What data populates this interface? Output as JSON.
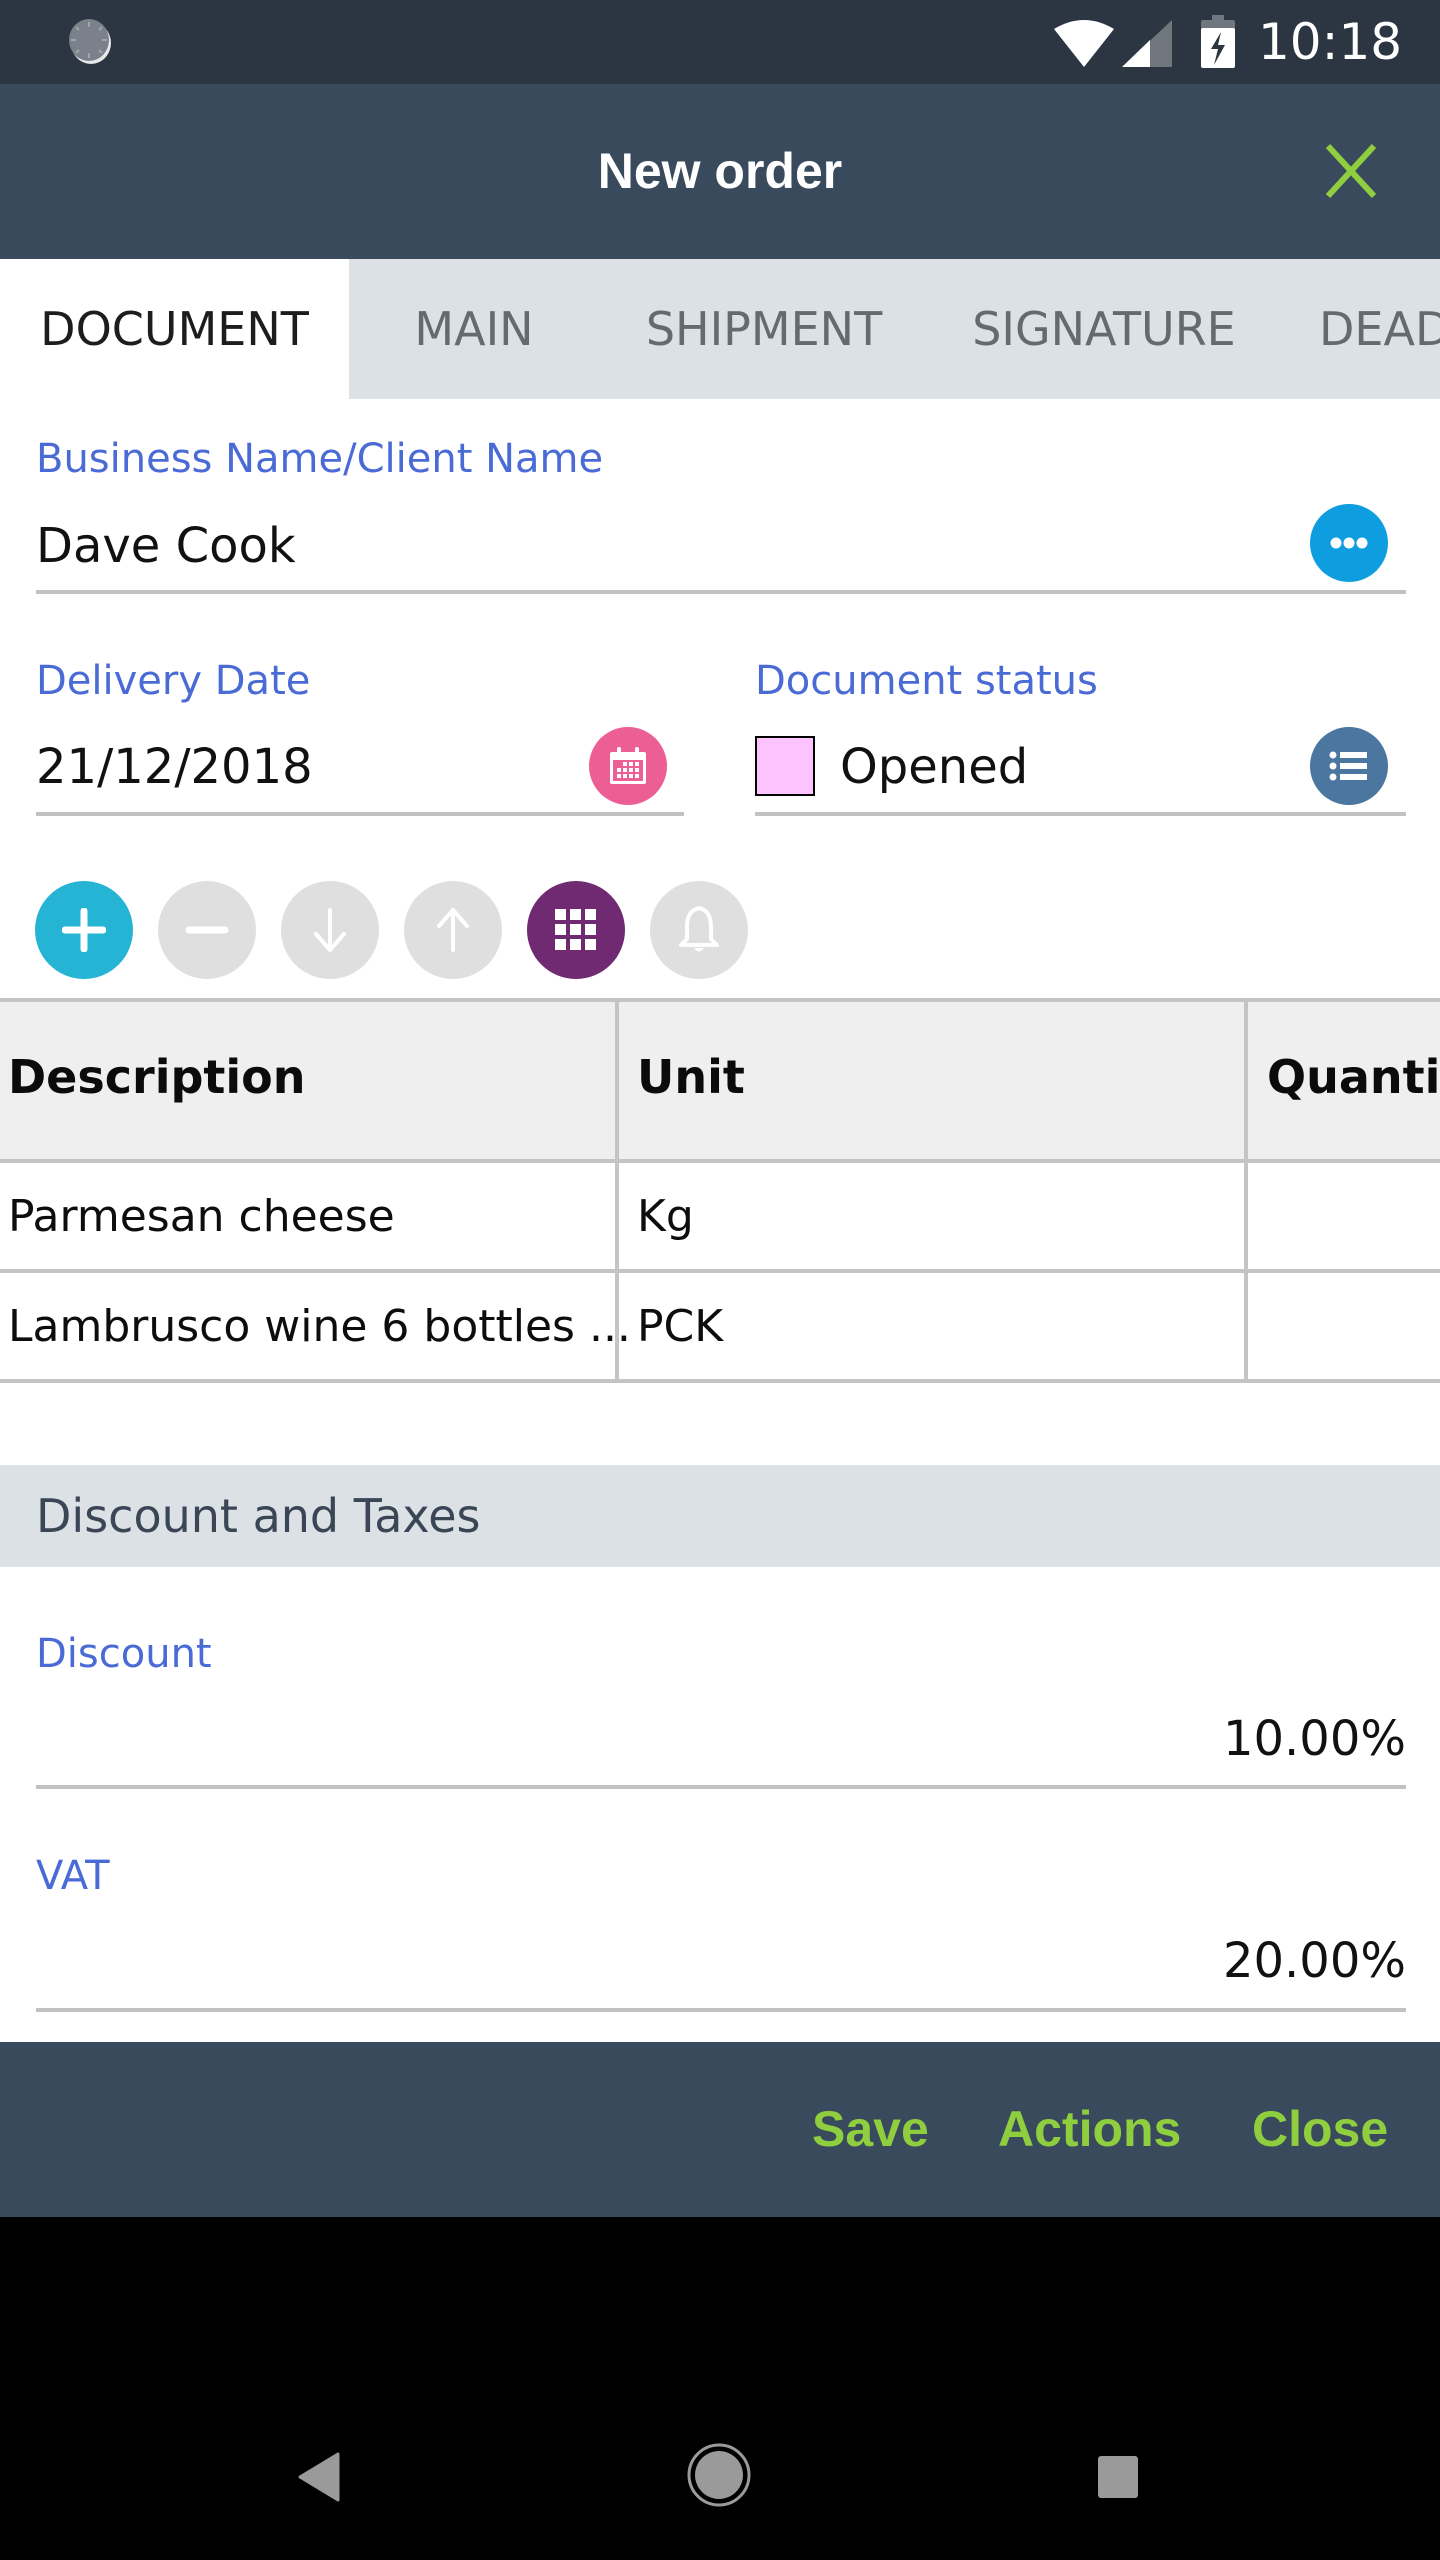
{
  "status_bar": {
    "time": "10:18",
    "icons": [
      "loading-indicator-icon",
      "wifi-icon",
      "cell-signal-icon",
      "battery-charging-icon"
    ]
  },
  "app_bar": {
    "title": "New order",
    "close_icon": "close-icon",
    "accent_color": "#8fce3f"
  },
  "tabs": [
    {
      "label": "DOCUMENT",
      "active": true
    },
    {
      "label": "MAIN",
      "active": false
    },
    {
      "label": "SHIPMENT",
      "active": false
    },
    {
      "label": "SIGNATURE",
      "active": false
    },
    {
      "label": "DEAD",
      "active": false
    }
  ],
  "form": {
    "client": {
      "label": "Business Name/Client Name",
      "value": "Dave Cook",
      "button_icon": "more-dots-icon",
      "button_color": "#0e9ee0"
    },
    "delivery_date": {
      "label": "Delivery Date",
      "value": "21/12/2018",
      "button_icon": "calendar-icon",
      "button_color": "#ec5f95"
    },
    "document_status": {
      "label": "Document status",
      "value": "Opened",
      "swatch_color": "#fdc3ff",
      "button_icon": "list-icon",
      "button_color": "#4a76a0"
    }
  },
  "row_actions": [
    {
      "name": "add",
      "icon": "plus-icon",
      "color": "#25b4d3",
      "enabled": true
    },
    {
      "name": "remove",
      "icon": "minus-icon",
      "color": "#dfdfdf",
      "enabled": false
    },
    {
      "name": "move-down",
      "icon": "arrow-down-icon",
      "color": "#dfdfdf",
      "enabled": false
    },
    {
      "name": "move-up",
      "icon": "arrow-up-icon",
      "color": "#dfdfdf",
      "enabled": false
    },
    {
      "name": "grid",
      "icon": "grid-icon",
      "color": "#702a72",
      "enabled": true
    },
    {
      "name": "notify",
      "icon": "bell-icon",
      "color": "#dfdfdf",
      "enabled": false
    }
  ],
  "table": {
    "columns": [
      "Description",
      "Unit",
      "Quantity"
    ],
    "rows": [
      [
        "Parmesan cheese",
        "Kg",
        ""
      ],
      [
        "Lambrusco wine 6 bottles ...",
        "PCK",
        ""
      ]
    ]
  },
  "discount_section": {
    "title": "Discount and Taxes",
    "discount": {
      "label": "Discount",
      "value": "10.00%"
    },
    "vat": {
      "label": "VAT",
      "value": "20.00%"
    }
  },
  "footer": {
    "save": "Save",
    "actions": "Actions",
    "close": "Close"
  },
  "nav_bar": {
    "icons": [
      "back-icon",
      "home-icon",
      "recents-icon"
    ]
  }
}
